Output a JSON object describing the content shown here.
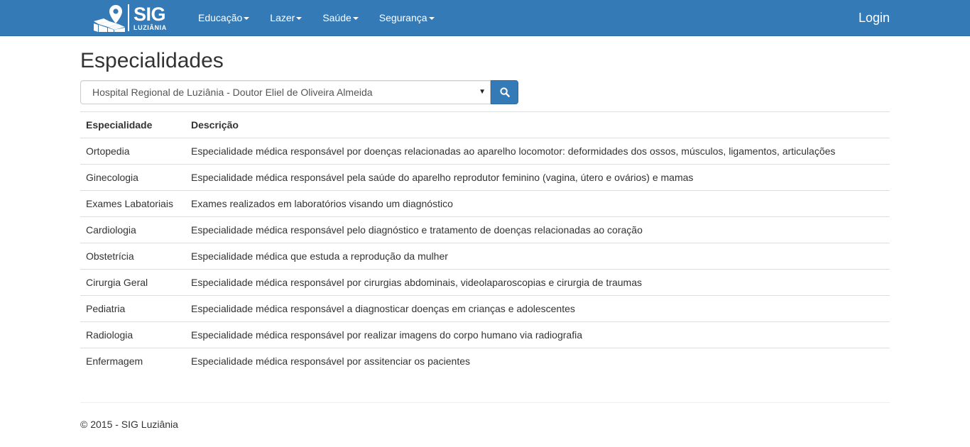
{
  "brand": {
    "name": "SIG",
    "city": "LUZIÂNIA"
  },
  "nav": {
    "items": [
      {
        "label": "Educação"
      },
      {
        "label": "Lazer"
      },
      {
        "label": "Saúde"
      },
      {
        "label": "Segurança"
      }
    ],
    "login": "Login"
  },
  "page": {
    "title": "Especialidades"
  },
  "search": {
    "selected_value": "Hospital Regional de Luziânia - Doutor Eliel de Oliveira Almeida",
    "button_icon": "search-icon"
  },
  "table": {
    "headers": [
      "Especialidade",
      "Descrição"
    ],
    "rows": [
      [
        "Ortopedia",
        "Especialidade médica responsável por doenças relacionadas ao aparelho locomotor: deformidades dos ossos, músculos, ligamentos, articulações"
      ],
      [
        "Ginecologia",
        "Especialidade médica responsável pela saúde do aparelho reprodutor feminino (vagina, útero e ovários) e mamas"
      ],
      [
        "Exames Labatoriais",
        "Exames realizados em laboratórios visando um diagnóstico"
      ],
      [
        "Cardiologia",
        "Especialidade médica responsável pelo diagnóstico e tratamento de doenças relacionadas ao coração"
      ],
      [
        "Obstetrícia",
        "Especialidade médica que estuda a reprodução da mulher"
      ],
      [
        "Cirurgia Geral",
        "Especialidade médica responsável por cirurgias abdominais, videolaparoscopias e cirurgia de traumas"
      ],
      [
        "Pediatria",
        "Especialidade médica responsável a diagnosticar doenças em crianças e adolescentes"
      ],
      [
        "Radiologia",
        "Especialidade médica responsável por realizar imagens do corpo humano via radiografia"
      ],
      [
        "Enfermagem",
        "Especialidade médica responsável por assitenciar os pacientes"
      ]
    ]
  },
  "footer": {
    "text": "© 2015 - SIG Luziânia"
  },
  "colors": {
    "navbar": "#337ab7",
    "button": "#337ab7",
    "text": "#333333",
    "border": "#dddddd"
  }
}
